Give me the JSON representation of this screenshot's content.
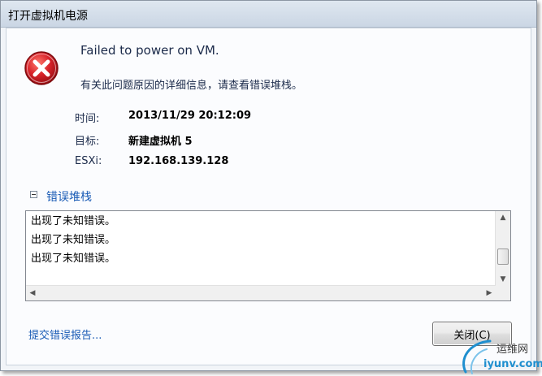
{
  "window": {
    "title": "打开虚拟机电源"
  },
  "error": {
    "icon": "error-x-icon",
    "headline": "Failed to power on VM.",
    "subline": "有关此问题原因的详细信息，请查看错误堆栈。"
  },
  "details": [
    {
      "label": "时间:",
      "value": "2013/11/29 20:12:09"
    },
    {
      "label": "目标:",
      "value": "新建虚拟机 5"
    },
    {
      "label": "ESXi:",
      "value": "192.168.139.128"
    }
  ],
  "stack": {
    "title": "错误堆栈",
    "toggle_icon": "collapse-minus-icon",
    "lines": [
      "出现了未知错误。",
      "出现了未知错误。",
      "出现了未知错误。"
    ]
  },
  "footer": {
    "report_link": "提交错误报告...",
    "close_button": "关闭(C)"
  },
  "watermark": {
    "line1": "运维网",
    "line2": "iyunv.com"
  },
  "colors": {
    "link": "#1a5bb5",
    "error_red": "#c8161d"
  }
}
